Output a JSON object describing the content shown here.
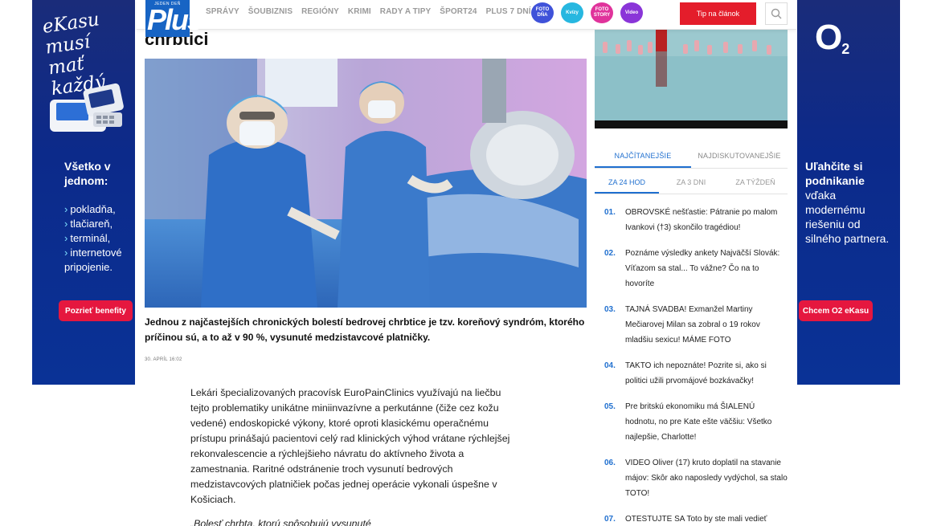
{
  "ad_left": {
    "headline": "eKasu musí mať každý",
    "title": "Všetko v jednom:",
    "items": [
      "pokladňa,",
      "tlačiareň,",
      "terminál,",
      "internetové pripojenie."
    ],
    "button": "Pozrieť benefity"
  },
  "ad_right": {
    "logo": "O",
    "logo_sub": "2",
    "text_bold": "Uľahčite si podnikanie",
    "text_rest": "vďaka modernému riešeniu od silného partnera.",
    "button": "Chcem O2 eKasu"
  },
  "header": {
    "logo_small": "JEDEN DEŇ",
    "logo": "Plus",
    "nav": [
      "SPRÁVY",
      "ŠOUBIZNIS",
      "REGIÓNY",
      "KRIMI",
      "RADY A TIPY",
      "ŠPORT24",
      "PLUS 7 DNÍ"
    ],
    "badges": [
      {
        "label": "FOTO DŇA",
        "color": "#3f52d9"
      },
      {
        "label": "Kvízy",
        "color": "#27b7e0"
      },
      {
        "label": "FOTO STORY",
        "color": "#e0339b"
      },
      {
        "label": "Video",
        "color": "#8a35d8"
      }
    ],
    "tip_button": "Tip na článok",
    "search_icon": "search-icon"
  },
  "article": {
    "title_fragment": "chrbtici",
    "lead": "Jednou z najčastejších chronických bolestí bedrovej chrbtice je tzv. koreňový syndróm, ktorého príčinou sú, a to až v 90 %, vysunuté medzistavcové platničky.",
    "date": "30. APRÍL 16:02",
    "body": "Lekári špecializovaných pracovísk EuroPainClinics využívajú na liečbu tejto problematiky unikátne miniinvazívne a perkutánne (čiže cez kožu vedené) endoskopické výkony, ktoré oproti klasickému operačnému prístupu prinášajú pacientovi celý rad klinických výhod vrátane rýchlejšej rekonvalescencie a rýchlejšieho návratu do aktívneho života a zamestnania. Raritné odstránenie troch vysunutí bedrových medzistavcových platničiek počas jednej operácie vykonali úspešne v Košiciach.",
    "body_next": "„Bolesť chrbta, ktorú spôsobujú vysunuté"
  },
  "sidebar": {
    "tabs_primary": [
      "NAJČÍTANEJŠIE",
      "NAJDISKUTOVANEJŠIE"
    ],
    "tabs_secondary": [
      "ZA 24 HOD",
      "ZA 3 DNI",
      "ZA TÝŽDEŇ"
    ],
    "ranking": [
      {
        "num": "01.",
        "text": "OBROVSKÉ nešťastie: Pátranie po malom Ivankovi (†3) skončilo tragédiou!"
      },
      {
        "num": "02.",
        "text": "Poznáme výsledky ankety Najväčší Slovák: Víťazom sa stal... To vážne? Čo na to hovoríte"
      },
      {
        "num": "03.",
        "text": "TAJNÁ SVADBA! Exmanžel Martiny Mečiarovej Milan sa zobral o 19 rokov mladšiu sexicu! MÁME FOTO"
      },
      {
        "num": "04.",
        "text": "TAKTO ich nepoznáte! Pozrite si, ako si politici užili prvomájové bozkávačky!"
      },
      {
        "num": "05.",
        "text": "Pre britskú ekonomiku má ŠIALENÚ hodnotu, no pre Kate ešte väčšiu: Všetko najlepšie, Charlotte!"
      },
      {
        "num": "06.",
        "text": "VIDEO Oliver (17) kruto doplatil na stavanie májov: Skôr ako naposledy vydýchol, sa stalo TOTO!"
      },
      {
        "num": "07.",
        "text": "OTESTUJTE SA Toto by ste mali vedieť"
      }
    ]
  }
}
